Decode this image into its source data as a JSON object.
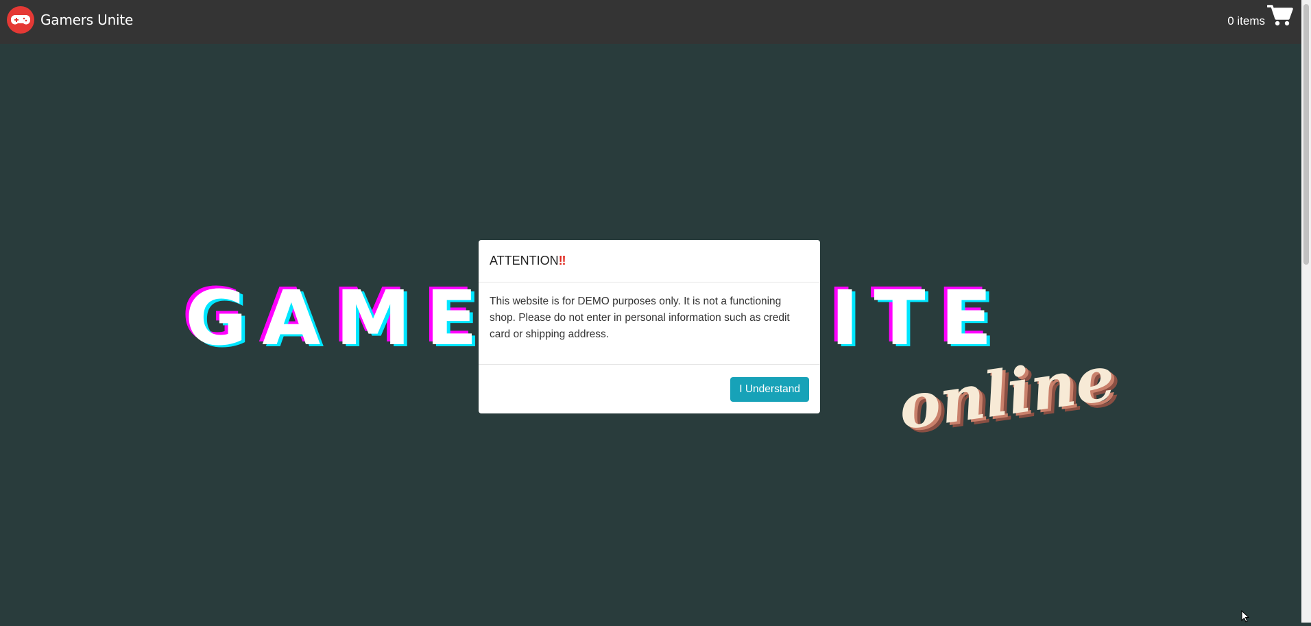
{
  "navbar": {
    "brand_name": "Gamers Unite",
    "brand_icon": "gamepad-icon",
    "cart_count_label": "0 items",
    "cart_icon": "shopping-cart-icon"
  },
  "hero": {
    "title": "GAMERS UNITE",
    "subtitle": "online"
  },
  "modal": {
    "title": "ATTENTION",
    "title_mark": "‼",
    "body": "This website is for DEMO purposes only. It is not a functioning shop. Please do not enter in personal information such as credit card or shipping address.",
    "confirm_label": "I Understand"
  },
  "colors": {
    "navbar_bg": "#343434",
    "page_bg": "#293c3c",
    "accent": "#17a2b8",
    "brand_red": "#e53935",
    "title_magenta": "#ff00ff",
    "title_cyan": "#00e6ff"
  }
}
